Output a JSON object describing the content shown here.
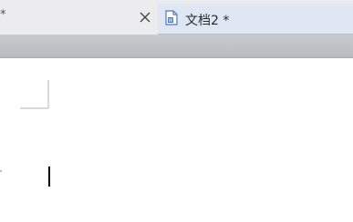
{
  "tabs": {
    "previous": {
      "modified_marker": "*"
    },
    "active": {
      "title": "文档2 *"
    }
  },
  "icons": {
    "close": "close-icon",
    "document": "wps-document-icon"
  },
  "colors": {
    "active_tab_bg": "#dfe7f3",
    "active_tab_border": "#a7c0e0",
    "toolbar_strip": "#bfc2c7"
  }
}
